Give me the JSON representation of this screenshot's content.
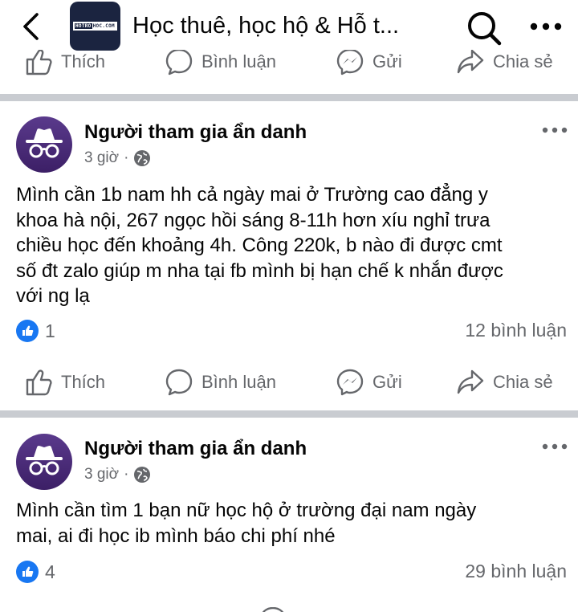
{
  "header": {
    "title": "Học thuê, học hộ & Hỗ t...",
    "logo_text_a": "HOTRO",
    "logo_text_b": "HOC.COM"
  },
  "actions": {
    "like": "Thích",
    "comment": "Bình luận",
    "send": "Gửi",
    "share": "Chia sẻ"
  },
  "posts": [
    {
      "author": "Người tham gia ẩn danh",
      "time": "3 giờ",
      "separator": "·",
      "lines": [
        "Mình cần 1b nam hh cả ngày mai ở Trường cao đẳng y",
        "khoa hà nội, 267 ngọc hồi  sáng 8-11h hơn xíu nghỉ trưa",
        "chiều học đến khoảng 4h. Công 220k, b nào đi được cmt",
        "số đt zalo giúp m nha tại fb mình bị hạn chế k nhắn được",
        "với ng lạ"
      ],
      "likes": "1",
      "comments": "12 bình luận"
    },
    {
      "author": "Người tham gia ẩn danh",
      "time": "3 giờ",
      "separator": "·",
      "lines": [
        "Mình cần tìm 1 bạn nữ học hộ ở trường đại nam ngày",
        "mai, ai đi học ib mình báo chi phí nhé"
      ],
      "likes": "4",
      "comments": "29 bình luận"
    }
  ],
  "colors": {
    "facebook_blue": "#1877f2",
    "secondary_text": "#65676b",
    "divider": "#c9ccd1",
    "avatar_purple": "#4b2a7a"
  }
}
